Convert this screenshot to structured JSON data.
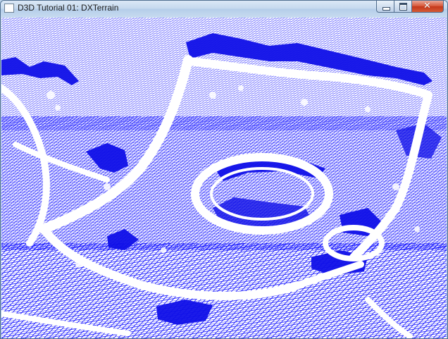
{
  "window": {
    "title": "D3D Tutorial 01: DXTerrain",
    "icon": "app-window-icon",
    "controls": {
      "minimize_icon": "minimize-icon",
      "maximize_icon": "maximize-icon",
      "close_glyph": "✕"
    }
  },
  "viewport": {
    "content": "wireframe terrain render",
    "background_color": "#ffffff",
    "wire_color": "#0000ff"
  }
}
